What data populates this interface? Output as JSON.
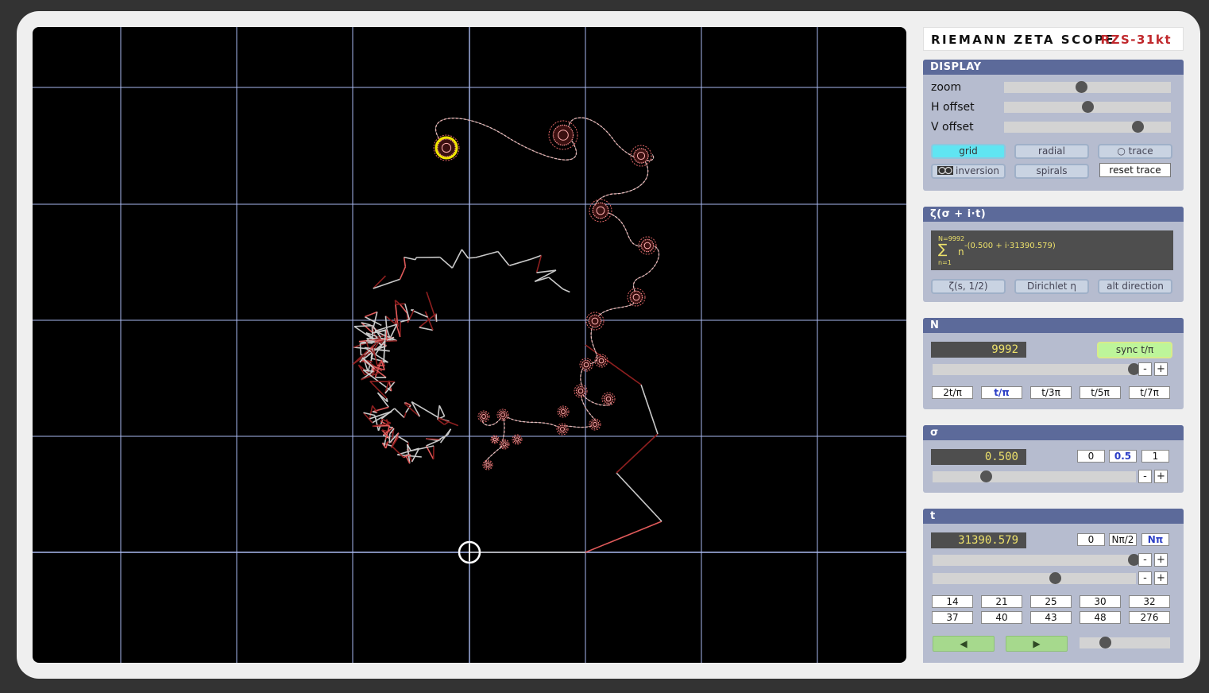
{
  "app": {
    "title": "RIEMANN ZETA SCOPE",
    "code": "RZS-31kt"
  },
  "display": {
    "header": "DISPLAY",
    "zoom_label": "zoom",
    "zoom_value": 0.46,
    "hoffset_label": "H offset",
    "hoffset_value": 0.5,
    "voffset_label": "V offset",
    "voffset_value": 0.8,
    "grid_label": "grid",
    "radial_label": "radial",
    "trace_label": "○ trace",
    "inversion_label": "inversion",
    "spirals_label": "spirals",
    "reset_label": "reset trace"
  },
  "zeta": {
    "header": "ζ(σ + i·t)",
    "sum_top": "N=9992",
    "sum_symbol": "∑",
    "sum_bottom": "n=1",
    "sum_base": "n",
    "sum_exp": "-(0.500 + i·31390.579)",
    "btn1": "ζ(s, 1/2)",
    "btn2": "Dirichlet η",
    "btn3": "alt direction"
  },
  "n_panel": {
    "header": "N",
    "value": "9992",
    "sync_label": "sync t/π",
    "slider_value": 0.99,
    "minus": "-",
    "plus": "+",
    "divs": [
      "2t/π",
      "t/π",
      "t/3π",
      "t/5π",
      "t/7π"
    ]
  },
  "sigma": {
    "header": "σ",
    "value": "0.500",
    "presets": [
      "0",
      "0.5",
      "1"
    ],
    "slider_value": 0.26,
    "minus": "-",
    "plus": "+"
  },
  "t_panel": {
    "header": "t",
    "value": "31390.579",
    "presets": [
      "0",
      "Nπ/2",
      "Nπ"
    ],
    "coarse_value": 0.99,
    "fine_value": 0.6,
    "minus": "-",
    "plus": "+",
    "zeros_row1": [
      "14",
      "21",
      "25",
      "30",
      "32"
    ],
    "zeros_row2": [
      "37",
      "40",
      "43",
      "48",
      "276"
    ],
    "back": "◀",
    "forward": "▶",
    "speed_value": 0.28
  },
  "colors": {
    "accent": "#5c6a9a",
    "grid": "#a9b9f0",
    "path": "#e05a5a",
    "marker": "#f2e400"
  }
}
